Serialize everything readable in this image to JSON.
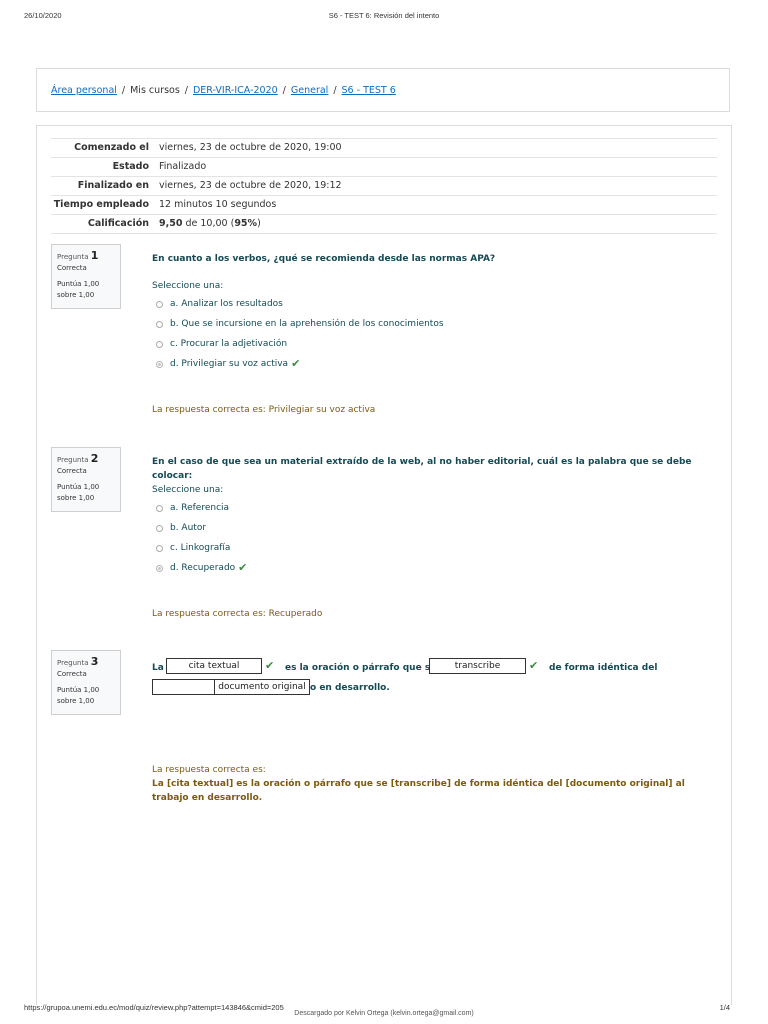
{
  "print": {
    "date": "26/10/2020",
    "title": "S6 - TEST 6: Revisión del intento",
    "url": "https://grupoa.unemi.edu.ec/mod/quiz/review.php?attempt=143846&cmid=205",
    "page": "1/4",
    "download_note": "Descargado por Kelvin Ortega (kelvin.ortega@gmail.com)"
  },
  "breadcrumb": [
    "Área personal",
    "Mis cursos",
    "DER-VIR-ICA-2020",
    "General",
    "S6 - TEST 6"
  ],
  "summary": [
    {
      "label": "Comenzado el",
      "value": "viernes, 23 de octubre de 2020, 19:00"
    },
    {
      "label": "Estado",
      "value": "Finalizado"
    },
    {
      "label": "Finalizado en",
      "value": "viernes, 23 de octubre de 2020, 19:12"
    },
    {
      "label": "Tiempo empleado",
      "value": "12 minutos 10 segundos"
    },
    {
      "label": "Calificación",
      "score": "9,50",
      "of": "de 10,00 (",
      "pct": "95%",
      "close": ")"
    }
  ],
  "q1": {
    "label": "Pregunta",
    "number": "1",
    "state": "Correcta",
    "grade": "Puntúa 1,00 sobre 1,00",
    "text": "En cuanto a los verbos, ¿qué se recomienda desde las normas APA?",
    "prompt": "Seleccione una:",
    "options": [
      "a. Analizar los resultados",
      "b. Que se incursione en la aprehensión de los conocimientos",
      "c. Procurar la adjetivación",
      "d. Privilegiar su voz activa"
    ],
    "feedback": "La respuesta correcta es: Privilegiar su voz activa"
  },
  "q2": {
    "label": "Pregunta",
    "number": "2",
    "state": "Correcta",
    "grade": "Puntúa 1,00 sobre 1,00",
    "text": "En el caso de que sea un material extraído de la web, al no haber editorial, cuál es la palabra que se debe colocar:",
    "prompt": "Seleccione una:",
    "options": [
      "a. Referencia",
      "b. Autor",
      "c. Linkografía",
      "d. Recuperado"
    ],
    "feedback": "La respuesta correcta es: Recuperado"
  },
  "q3": {
    "label": "Pregunta",
    "number": "3",
    "state": "Correcta",
    "grade": "Puntúa 1,00 sobre 1,00",
    "t1": "La",
    "gap1": "cita textual",
    "t2": "es la oración o párrafo que se",
    "gap2": "transcribe",
    "t3": "de forma idéntica del",
    "gap3": "documento original",
    "t4": "o en desarrollo.",
    "feedback_title": "La respuesta correcta es:",
    "feedback_text": "La [cita textual] es la oración o párrafo que se [transcribe] de forma idéntica del  [documento original] al trabajo en desarrollo."
  },
  "colors": {
    "link": "#0f6cbf",
    "question": "#154a55",
    "feedback": "#7d5a10",
    "correct": "#3a8a3a"
  }
}
